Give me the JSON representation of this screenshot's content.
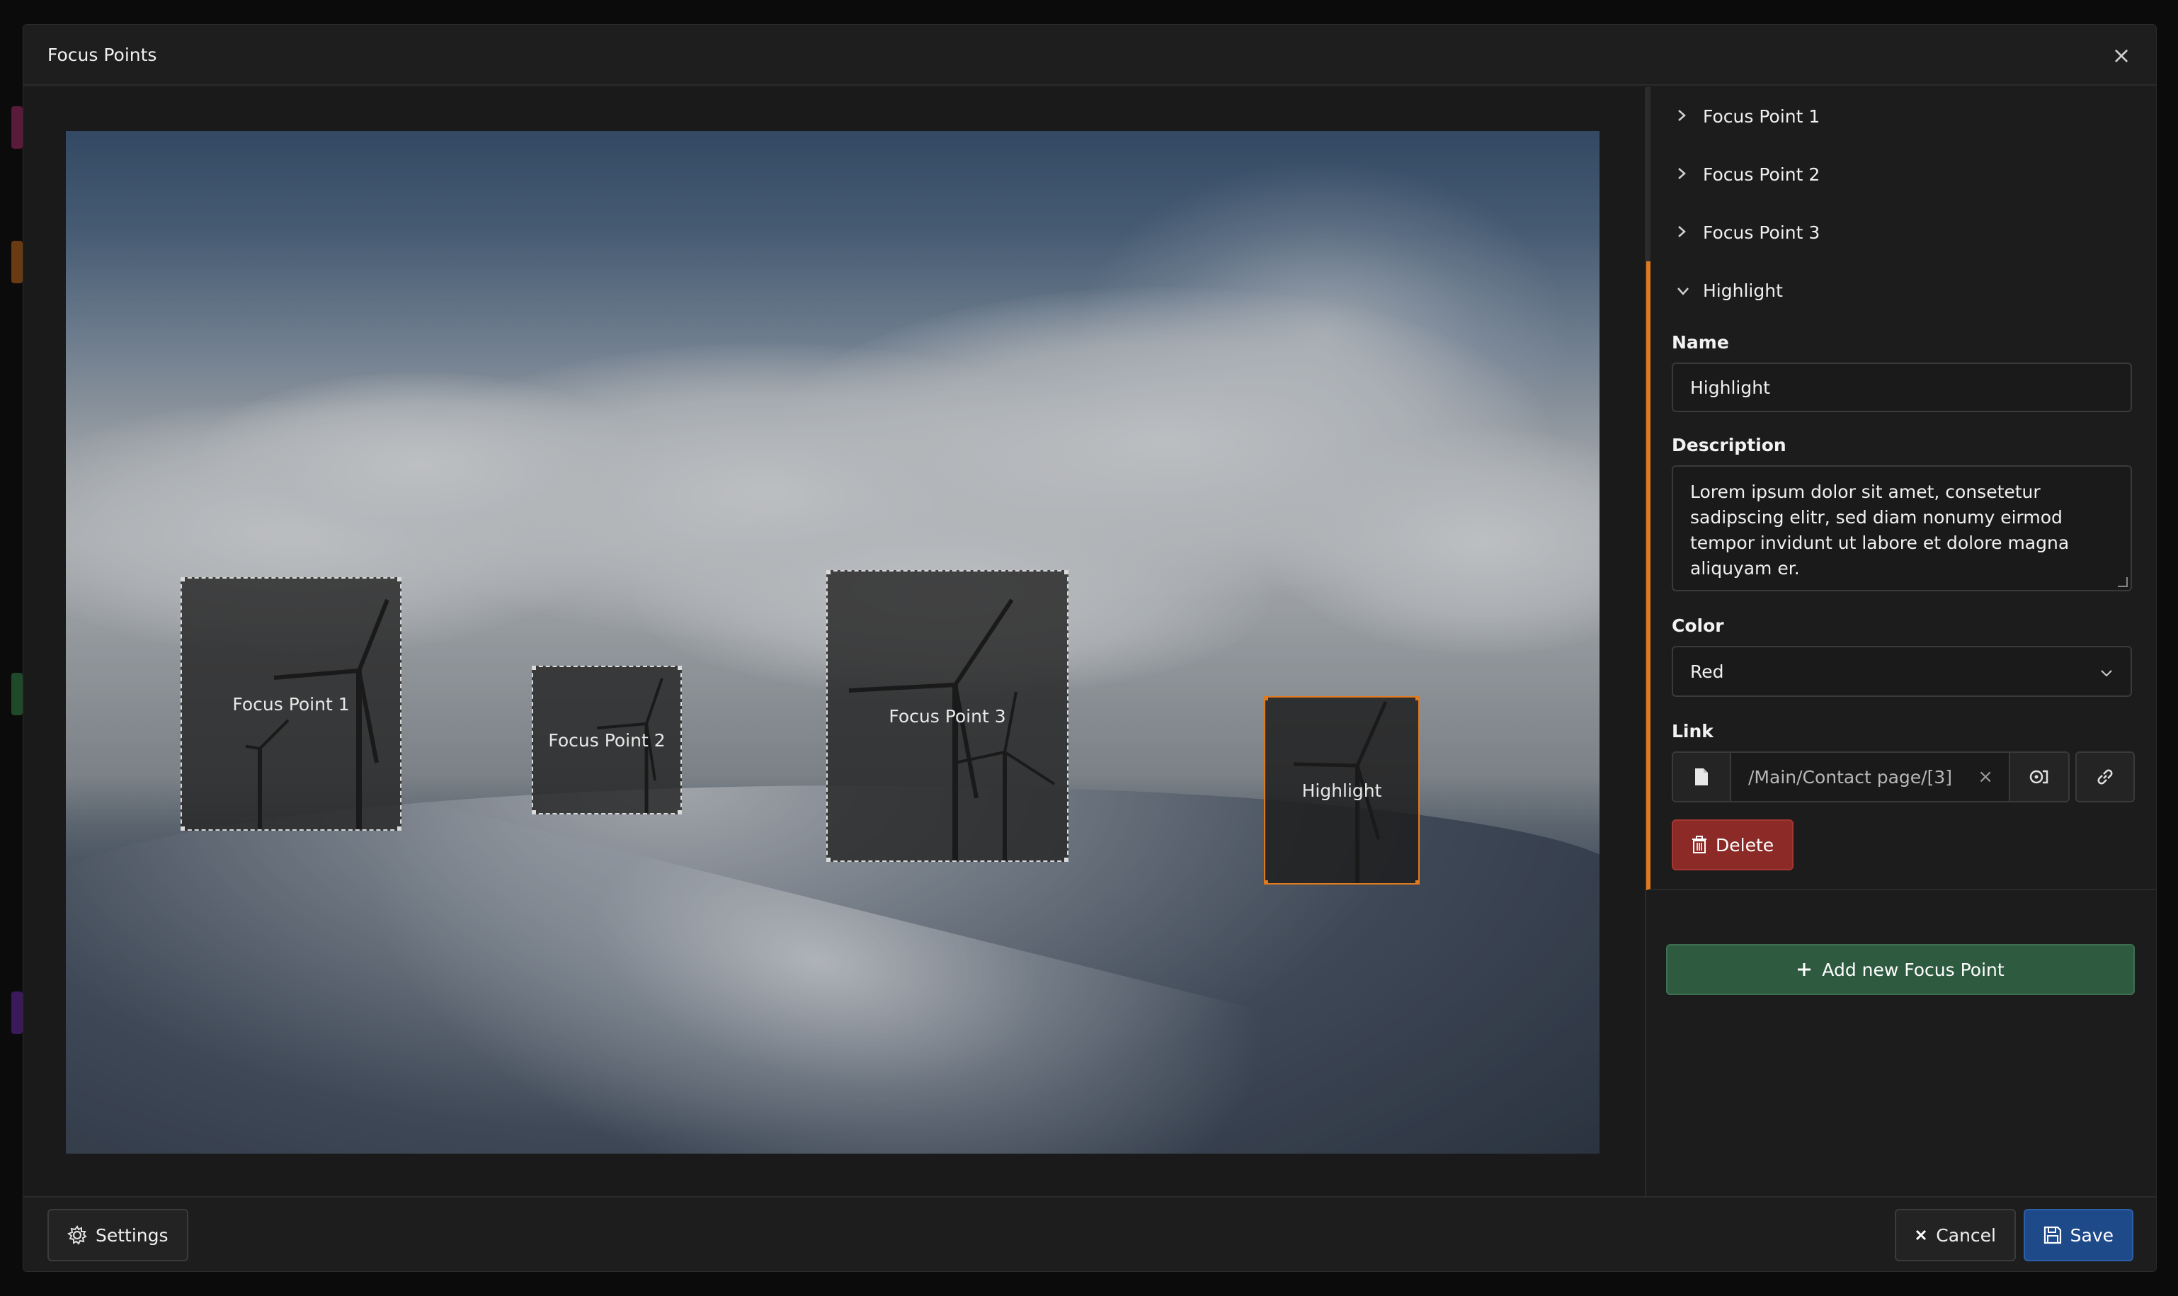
{
  "modal": {
    "title": "Focus Points",
    "close_glyph": "×"
  },
  "image": {
    "focus_points": [
      {
        "label": "Focus Point 1",
        "active": false
      },
      {
        "label": "Focus Point 2",
        "active": false
      },
      {
        "label": "Focus Point 3",
        "active": false
      },
      {
        "label": "Highlight",
        "active": true
      }
    ]
  },
  "sidebar": {
    "items": [
      {
        "label": "Focus Point 1",
        "expanded": false
      },
      {
        "label": "Focus Point 2",
        "expanded": false
      },
      {
        "label": "Focus Point 3",
        "expanded": false
      },
      {
        "label": "Highlight",
        "expanded": true
      }
    ],
    "form": {
      "name_label": "Name",
      "name_value": "Highlight",
      "description_label": "Description",
      "description_value": "Lorem ipsum dolor sit amet, consetetur sadipscing elitr, sed diam nonumy eirmod tempor invidunt ut labore et dolore magna aliquyam er.",
      "color_label": "Color",
      "color_value": "Red",
      "link_label": "Link",
      "link_value": "/Main/Contact page/[3]",
      "link_clear_glyph": "×",
      "delete_label": "Delete"
    },
    "add_label": "Add new Focus Point"
  },
  "footer": {
    "settings_label": "Settings",
    "cancel_label": "Cancel",
    "save_label": "Save"
  },
  "colors": {
    "accent_orange": "#e07a1f",
    "save_blue": "#1f4a8a",
    "delete_red": "#8b2a26",
    "add_green": "#2e5a3f"
  },
  "icons": {
    "close": "close-icon",
    "chevron_right": "chevron-right-icon",
    "chevron_down": "chevron-down-icon",
    "file": "file-icon",
    "link": "link-icon",
    "page_select": "page-select-icon",
    "trash": "trash-icon",
    "plus": "plus-icon",
    "gear": "gear-icon",
    "save": "save-icon"
  }
}
